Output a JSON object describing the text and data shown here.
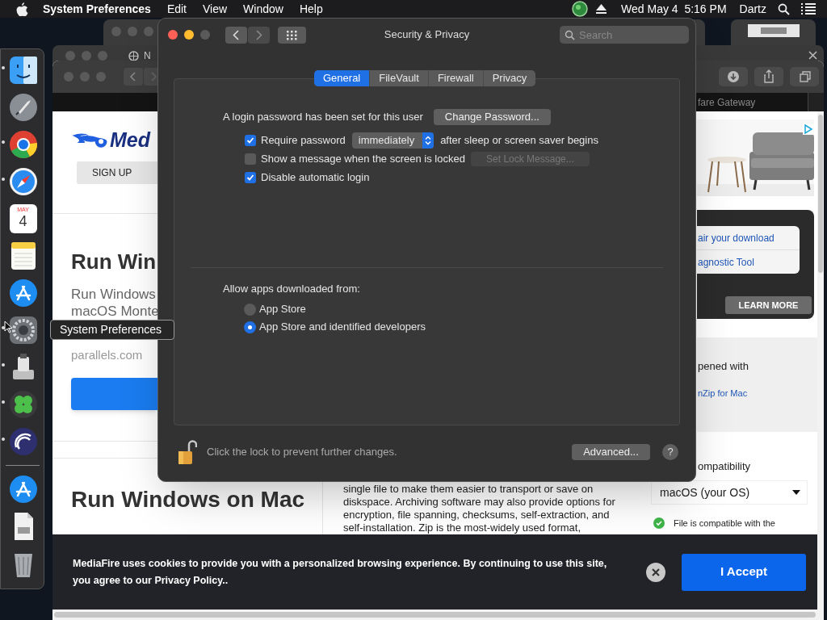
{
  "menu_bar": {
    "app": "System Preferences",
    "menus": [
      "Edit",
      "View",
      "Window",
      "Help"
    ],
    "clock": "Wed May 4  5:16 PM",
    "user": "Dartz"
  },
  "dock": {
    "items": [
      {
        "kind": "finder",
        "running": true
      },
      {
        "kind": "rocket",
        "running": false
      },
      {
        "kind": "chrome",
        "running": true
      },
      {
        "kind": "compass",
        "running": true
      },
      {
        "kind": "calendar",
        "running": false,
        "month": "MAY",
        "day": "4"
      },
      {
        "kind": "notes",
        "running": false
      },
      {
        "kind": "appstore",
        "running": false
      },
      {
        "kind": "gear",
        "running": true
      },
      {
        "kind": "utility",
        "running": true
      },
      {
        "kind": "clover",
        "running": true
      },
      {
        "kind": "circle",
        "running": true
      },
      {
        "kind": "divider"
      },
      {
        "kind": "appstore",
        "running": false
      },
      {
        "kind": "document",
        "running": false
      },
      {
        "kind": "trash",
        "running": false
      }
    ],
    "tooltip": "System Preferences"
  },
  "behind_window": {
    "tab_title": "N"
  },
  "browser": {
    "tab_title": "fare Gateway",
    "left": {
      "logo_text": "Med",
      "sign_up": "SIGN UP",
      "heading": "Run Win",
      "subtitle": "Run Windows\nmacOS Monte",
      "domain": "parallels.com",
      "heading_2": "Run Windows on Mac"
    },
    "middle": {
      "paragraph": "single file to make them easier to transport or save on diskspace. Archiving software may also provide options for encryption, file spanning, checksums, self-extraction, and self-installation. Zip is the most-widely used format,"
    },
    "right": {
      "links": [
        "air your download",
        "agnostic Tool"
      ],
      "learn_more": "LEARN MORE",
      "opened_with": "pened with",
      "app_link": "nZip for Mac",
      "compat_heading": "ompatibility",
      "os_select": "macOS (your OS)",
      "compat_note": "File is compatible with the"
    },
    "cookie_banner": {
      "text": "MediaFire uses cookies to provide you with a personalized browsing experience. By continuing to use this site, you agree to our Privacy Policy..",
      "accept": "I Accept"
    }
  },
  "dialog": {
    "title": "Security & Privacy",
    "search_placeholder": "Search",
    "tabs": [
      {
        "label": "General",
        "selected": true
      },
      {
        "label": "FileVault",
        "selected": false
      },
      {
        "label": "Firewall",
        "selected": false
      },
      {
        "label": "Privacy",
        "selected": false
      }
    ],
    "password_text": "A login password has been set for this user",
    "change_password": "Change Password...",
    "options": [
      {
        "kind": "delay",
        "label": "Require password",
        "checked": true,
        "popup": "immediately",
        "suffix": "after sleep or screen saver begins"
      },
      {
        "kind": "button",
        "label": "Show a message when the screen is locked",
        "checked": false,
        "button": "Set Lock Message...",
        "button_disabled": true
      },
      {
        "kind": "plain",
        "label": "Disable automatic login",
        "checked": true
      }
    ],
    "allow_label": "Allow apps downloaded from:",
    "sources": [
      {
        "label": "App Store",
        "selected": false
      },
      {
        "label": "App Store and identified developers",
        "selected": true
      }
    ],
    "locked": false,
    "lock_text": "Click the lock to prevent further changes.",
    "advanced": "Advanced...",
    "help": "?"
  }
}
